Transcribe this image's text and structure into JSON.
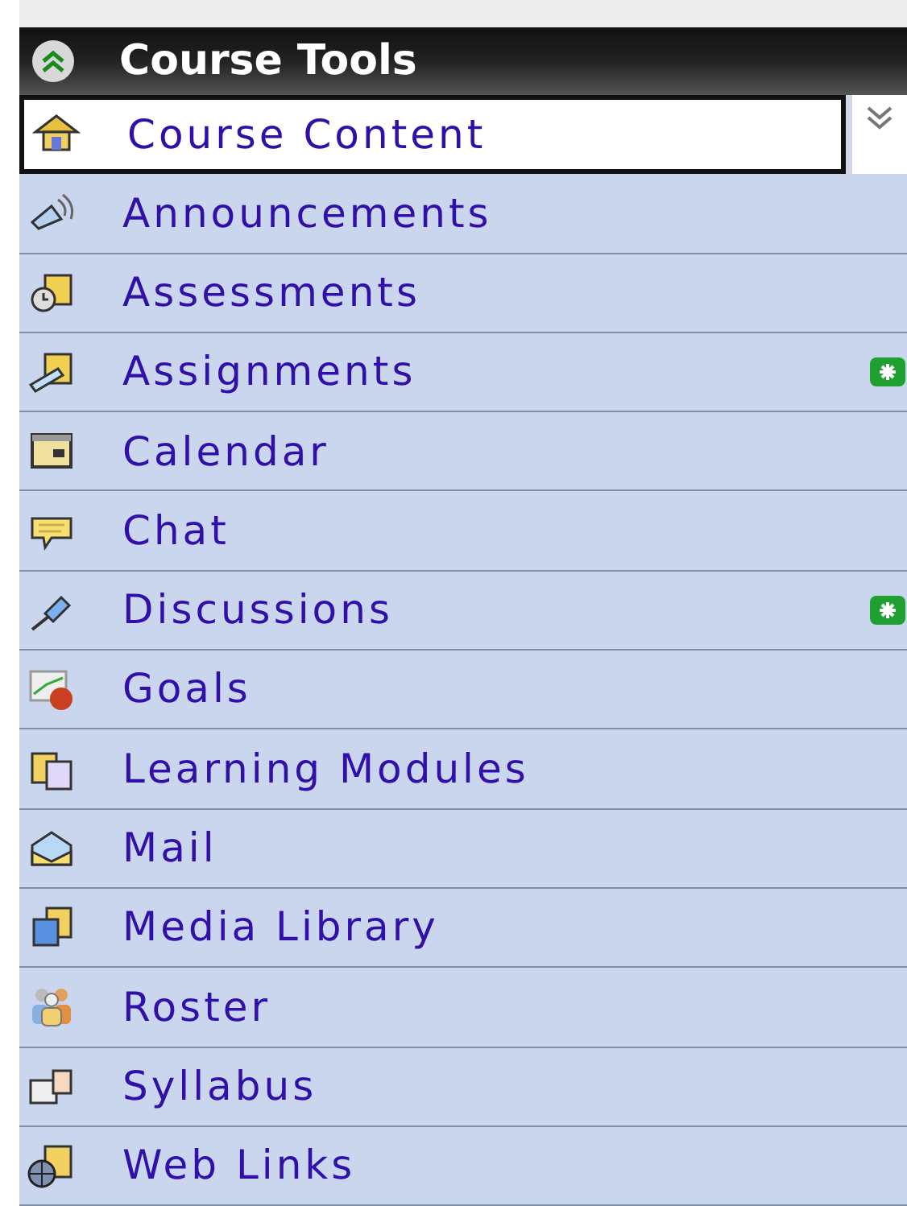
{
  "panel": {
    "title": "Course Tools"
  },
  "items": [
    {
      "label": "Course Content",
      "selected": true,
      "new": false
    },
    {
      "label": "Announcements",
      "selected": false,
      "new": false
    },
    {
      "label": "Assessments",
      "selected": false,
      "new": false
    },
    {
      "label": "Assignments",
      "selected": false,
      "new": true
    },
    {
      "label": "Calendar",
      "selected": false,
      "new": false
    },
    {
      "label": "Chat",
      "selected": false,
      "new": false
    },
    {
      "label": "Discussions",
      "selected": false,
      "new": true
    },
    {
      "label": "Goals",
      "selected": false,
      "new": false
    },
    {
      "label": "Learning Modules",
      "selected": false,
      "new": false
    },
    {
      "label": "Mail",
      "selected": false,
      "new": false
    },
    {
      "label": "Media Library",
      "selected": false,
      "new": false
    },
    {
      "label": "Roster",
      "selected": false,
      "new": false
    },
    {
      "label": "Syllabus",
      "selected": false,
      "new": false
    },
    {
      "label": "Web Links",
      "selected": false,
      "new": false
    }
  ]
}
